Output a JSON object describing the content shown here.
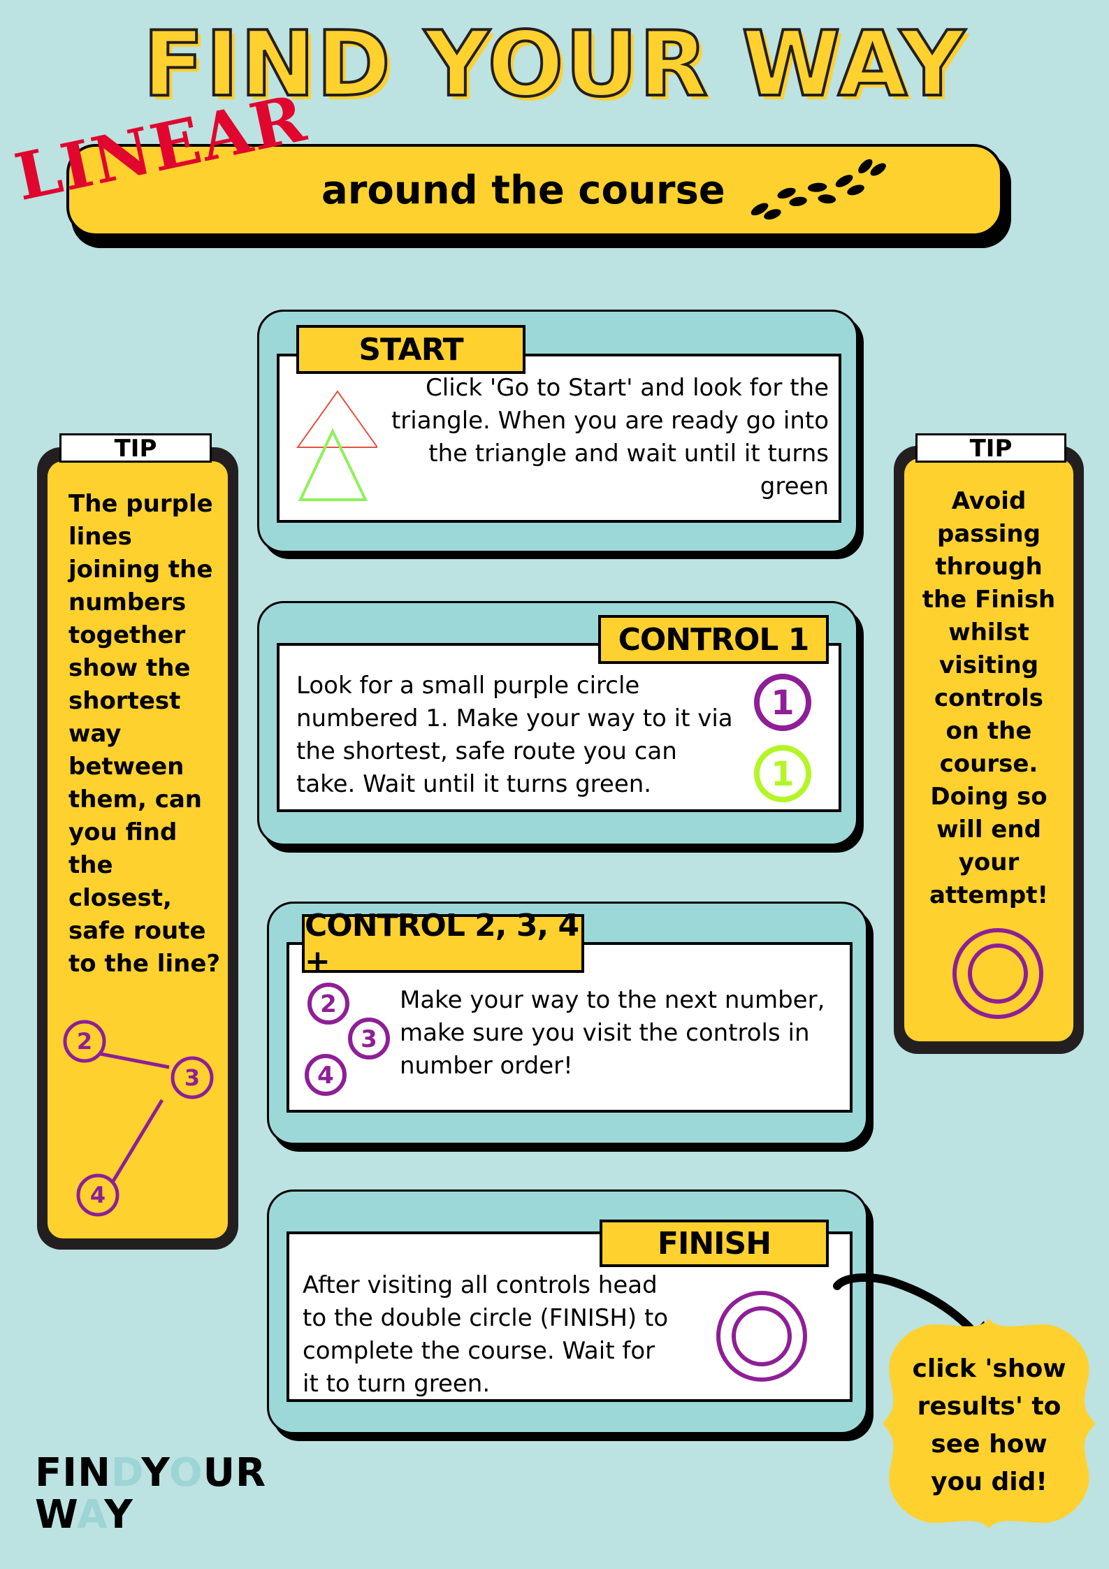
{
  "header": {
    "title": "FIND YOUR WAY",
    "mode_label": "LINEAR",
    "subtitle": "around the course",
    "footprints_icon": "footprints-icon"
  },
  "cards": {
    "start": {
      "label": "START",
      "text_lines": [
        "Click 'Go to Start' and look for the",
        "triangle. When you are ready go into",
        "the triangle and wait until it turns",
        "green"
      ],
      "icons": [
        "red-triangle-icon",
        "green-triangle-icon"
      ]
    },
    "control1": {
      "label": "CONTROL 1",
      "text_lines": [
        "Look for a small purple circle",
        "numbered 1. Make your way to it via",
        "the shortest, safe route you can",
        "take. Wait until it turns green."
      ],
      "markers": [
        {
          "number": "1",
          "color": "#8e1f96"
        },
        {
          "number": "1",
          "color": "#b4f527"
        }
      ]
    },
    "control234": {
      "label": "CONTROL 2, 3, 4 +",
      "text_lines": [
        "Make your way to the next number,",
        "make sure you visit the controls in",
        "number order!"
      ],
      "markers": [
        "2",
        "3",
        "4"
      ]
    },
    "finish": {
      "label": "FINISH",
      "text_lines": [
        "After visiting all controls head",
        "to the double circle (FINISH) to",
        "complete the course. Wait for",
        "it to turn green."
      ]
    }
  },
  "tips": {
    "left": {
      "label": "TIP",
      "text_lines": [
        "The purple",
        "lines",
        "joining the",
        "numbers",
        "together",
        "show the",
        "shortest",
        "way",
        "between",
        "them, can",
        "you find",
        "the",
        "closest,",
        "safe route",
        "to the line?"
      ],
      "diagram_markers": [
        "2",
        "3",
        "4"
      ]
    },
    "right": {
      "label": "TIP",
      "text_lines": [
        "Avoid",
        "passing",
        "through",
        "the Finish",
        "whilst",
        "visiting",
        "controls",
        "on the",
        "course.",
        "Doing so",
        "will end",
        "your",
        "attempt!"
      ]
    }
  },
  "callout": {
    "text_lines": [
      "click 'show",
      "results' to",
      "see how",
      "you did!"
    ]
  },
  "logo": {
    "line1_a": "FIN",
    "line1_b": "D",
    "line1_c": "Y",
    "line1_d": "O",
    "line1_e": "UR",
    "line2_a": "W",
    "line2_b": "A",
    "line2_c": "Y"
  },
  "colors": {
    "background": "#bce2e1",
    "yellow": "#ffd12f",
    "card_teal": "#9dd8d9",
    "purple": "#8e1f96",
    "green": "#b4f527",
    "red": "#e0062e"
  }
}
